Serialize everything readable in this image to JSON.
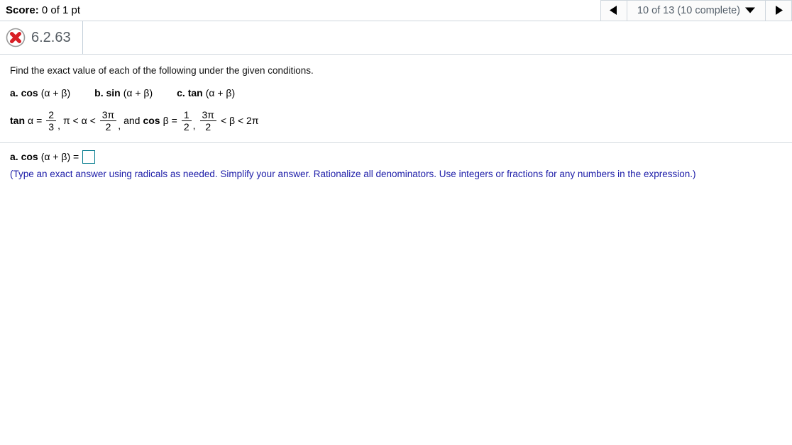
{
  "score_bar": {
    "label": "Score:",
    "value": "0 of 1 pt"
  },
  "navigation": {
    "prev_icon": "triangle-left-icon",
    "next_icon": "triangle-right-icon",
    "selector_label": "10 of 13 (10 complete)",
    "dropdown_icon": "chevron-down-icon"
  },
  "exercise": {
    "status_icon": "incorrect-x-icon",
    "id": "6.2.63"
  },
  "question": {
    "prompt": "Find the exact value of each of the following under the given conditions.",
    "parts": [
      {
        "lead": "a. cos",
        "arg": "(α + β)"
      },
      {
        "lead": "b. sin",
        "arg": "(α + β)"
      },
      {
        "lead": "c. tan",
        "arg": "(α + β)"
      }
    ],
    "conditions": {
      "tan_label": "tan",
      "alpha": "α",
      "equals": "=",
      "tan_alpha_num": "2",
      "tan_alpha_den": "3",
      "comma1": ",",
      "alpha_range_left": "π < α <",
      "alpha_range_num": "3π",
      "alpha_range_den": "2",
      "comma2": ",",
      "and_label": "and",
      "cos_label": "cos",
      "beta": "β",
      "cos_beta_num": "1",
      "cos_beta_den": "2",
      "comma3": ",",
      "beta_range_num": "3π",
      "beta_range_den": "2",
      "beta_range_right": "< β < 2π"
    }
  },
  "answer": {
    "label_lead": "a. cos",
    "label_arg": "(α + β) =",
    "input_value": "",
    "input_placeholder": "",
    "hint": "(Type an exact answer using radicals as needed. Simplify your answer. Rationalize all denominators. Use integers or fractions for any numbers in the expression.)"
  },
  "colors": {
    "hint_text": "#1c1ca8",
    "input_border": "#00798c",
    "exercise_id": "#555c63",
    "incorrect_red": "#d81f26",
    "border_gray": "#cfd6dd"
  }
}
